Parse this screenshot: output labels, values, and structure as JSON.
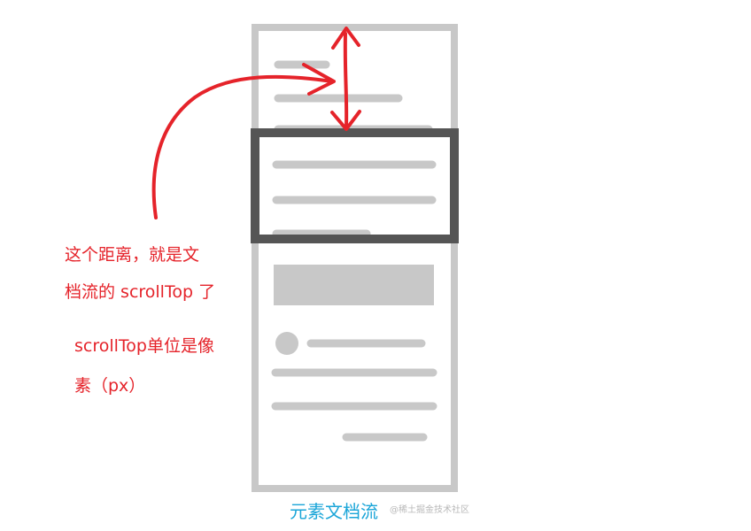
{
  "annotation": {
    "line1": "这个距离，就是文",
    "line2": "档流的 scrollTop 了"
  },
  "unit_note": {
    "line1": "scrollTop单位是像",
    "line2": "素（px）"
  },
  "caption": "元素文档流",
  "watermark": "@稀土掘金技术社区",
  "colors": {
    "annotation": "#e5232a",
    "caption": "#1aa5d8",
    "document_frame": "#c8c8c8",
    "viewport_frame": "#555555",
    "placeholder": "#c8c8c8"
  },
  "icons": {
    "arrow": "curved-arrow-icon",
    "distance": "double-arrow-icon"
  }
}
